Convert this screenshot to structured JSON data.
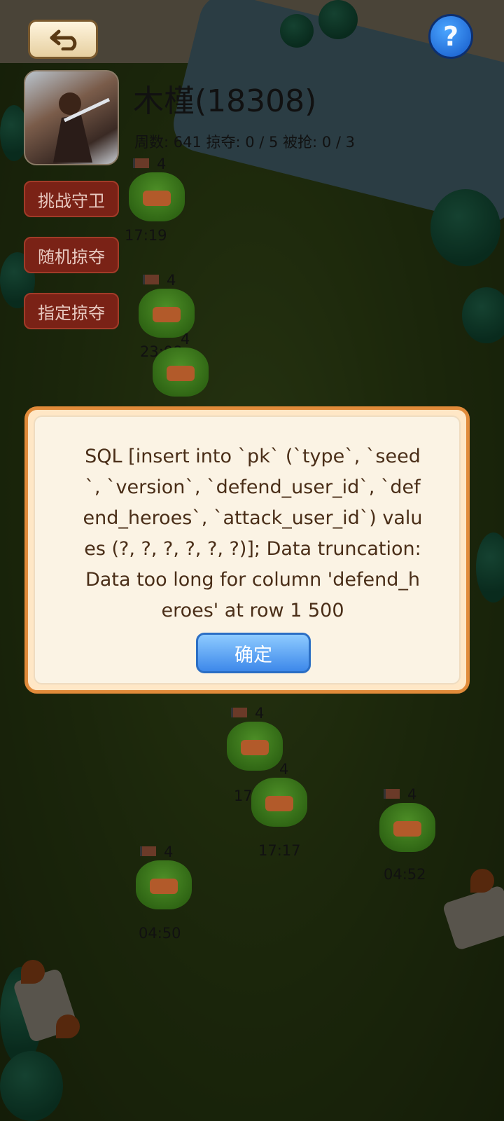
{
  "header": {
    "player_name": "木槿(18308)",
    "stats": "周数: 641  掠夺: 0 / 5  被抢: 0 / 3",
    "help_label": "?"
  },
  "side_buttons": [
    {
      "label": "挑战守卫"
    },
    {
      "label": "随机掠夺"
    },
    {
      "label": "指定掠夺"
    }
  ],
  "markers": [
    {
      "level": "4",
      "time": "17:19"
    },
    {
      "level": "4",
      "time": "23:08"
    },
    {
      "level": "4",
      "time": ""
    },
    {
      "level": "4",
      "time": "17:21"
    },
    {
      "level": "4",
      "time": "17:17"
    },
    {
      "level": "4",
      "time": "04:52"
    },
    {
      "level": "4",
      "time": "04:50"
    }
  ],
  "dialog": {
    "message": "SQL [insert into `pk` (`type`, `seed`, `version`, `defend_user_id`, `defend_heroes`, `attack_user_id`) values (?, ?, ?, ?, ?, ?)]; Data truncation: Data too long for column 'defend_heroes' at row 1 500",
    "ok_label": "确定"
  },
  "colors": {
    "dialog_border": "#e18b3a",
    "dialog_bg": "#fbf3e4",
    "ok_button": "#3d88ea",
    "side_button": "#7a2216"
  }
}
